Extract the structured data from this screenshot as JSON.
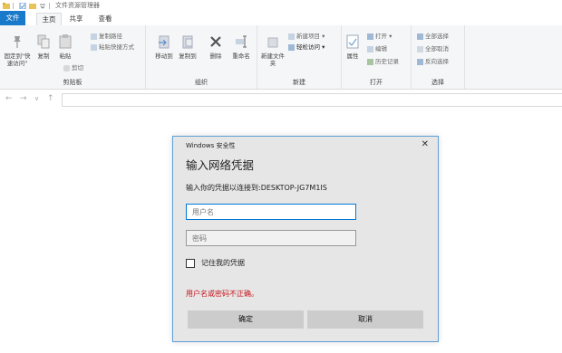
{
  "window": {
    "title": "文件资源管理器"
  },
  "tabs": {
    "file": "文件",
    "home": "主页",
    "share": "共享",
    "view": "查看"
  },
  "ribbon": {
    "clipboard": {
      "label": "剪贴板",
      "pin": "固定到\"快速访问\"",
      "copy": "复制",
      "paste": "粘贴",
      "copy_path": "复制路径",
      "paste_shortcut": "粘贴快捷方式",
      "cut": "剪切"
    },
    "organize": {
      "label": "组织",
      "move_to": "移动到",
      "copy_to": "复制到",
      "delete": "删除",
      "rename": "重命名"
    },
    "new": {
      "label": "新建",
      "new_folder": "新建文件夹",
      "new_item": "新建项目",
      "easy_access": "轻松访问"
    },
    "open": {
      "label": "打开",
      "properties": "属性",
      "open": "打开",
      "edit": "编辑",
      "history": "历史记录"
    },
    "select": {
      "label": "选择",
      "select_all": "全部选择",
      "select_none": "全部取消",
      "invert": "反向选择"
    }
  },
  "dialog": {
    "caption": "Windows 安全性",
    "title": "输入网络凭据",
    "message": "输入你的凭据以连接到:DESKTOP-JG7M1IS",
    "username_placeholder": "用户名",
    "password_placeholder": "密码",
    "remember": "记住我的凭据",
    "error": "用户名或密码不正确。",
    "ok": "确定",
    "cancel": "取消"
  },
  "colors": {
    "accent": "#1979ca",
    "error": "#c8161d",
    "dialog_border": "#5fa0d8"
  }
}
